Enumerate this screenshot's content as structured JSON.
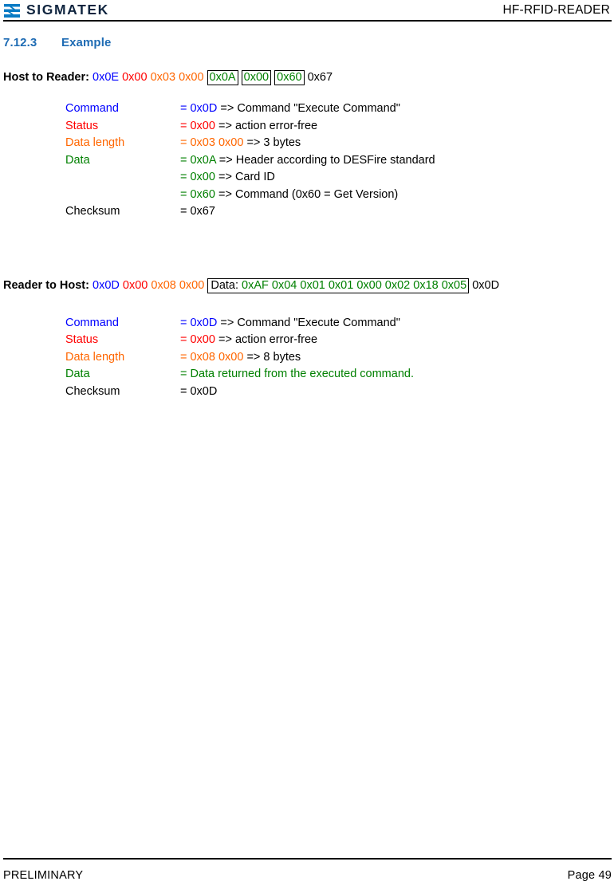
{
  "header": {
    "brand_name": "SIGMATEK",
    "logo_icon": "sigmatek-logo-icon",
    "document_title": "HF-RFID-READER"
  },
  "section": {
    "number": "7.12.3",
    "title": "Example"
  },
  "host_to_reader": {
    "lead": "Host to Reader:",
    "bytes": [
      {
        "text": "0x0E",
        "color": "#0000ff",
        "boxed": false
      },
      {
        "text": "0x00",
        "color": "#ff0000",
        "boxed": false
      },
      {
        "text": "0x03",
        "color": "#ff6600",
        "boxed": false
      },
      {
        "text": "0x00",
        "color": "#ff6600",
        "boxed": false
      },
      {
        "text": "0x0A",
        "color": "#008000",
        "boxed": true
      },
      {
        "text": "0x00",
        "color": "#008000",
        "boxed": true
      },
      {
        "text": "0x60",
        "color": "#008000",
        "boxed": true
      },
      {
        "text": "0x67",
        "color": "#000000",
        "boxed": false
      }
    ],
    "rows": [
      {
        "label": "Command",
        "label_color": "#0000ff",
        "value_prefix": "= 0x0D",
        "value_color": "#0000ff",
        "rest": " => Command \"Execute Command\""
      },
      {
        "label": "Status",
        "label_color": "#ff0000",
        "value_prefix": "= 0x00",
        "value_color": "#ff0000",
        "rest": " => action error-free"
      },
      {
        "label": "Data length",
        "label_color": "#ff6600",
        "value_prefix": "= 0x03 0x00",
        "value_color": "#ff6600",
        "rest": " => 3 bytes"
      },
      {
        "label": "Data",
        "label_color": "#008000",
        "value_prefix": "= 0x0A",
        "value_color": "#008000",
        "rest": " => Header according to DESFire standard"
      },
      {
        "label": "",
        "label_color": "#000000",
        "value_prefix": "= 0x00",
        "value_color": "#008000",
        "rest": " => Card ID"
      },
      {
        "label": "",
        "label_color": "#000000",
        "value_prefix": "= 0x60",
        "value_color": "#008000",
        "rest": " => Command (0x60 = Get Version)"
      },
      {
        "label": "Checksum",
        "label_color": "#000000",
        "value_prefix": "= 0x67",
        "value_color": "#000000",
        "rest": ""
      }
    ]
  },
  "reader_to_host": {
    "lead": "Reader to Host:",
    "bytes": [
      {
        "text": "0x0D",
        "color": "#0000ff"
      },
      {
        "text": "0x00",
        "color": "#ff0000"
      },
      {
        "text": "0x08",
        "color": "#ff6600"
      },
      {
        "text": "0x00",
        "color": "#ff6600"
      }
    ],
    "data_box_label": "Data:",
    "data_box_bytes": "0xAF 0x04 0x01 0x01 0x00 0x02 0x18 0x05",
    "trailing_byte": "0x0D",
    "rows": [
      {
        "label": "Command",
        "label_color": "#0000ff",
        "value_prefix": "= 0x0D",
        "value_color": "#0000ff",
        "rest": " => Command \"Execute Command\""
      },
      {
        "label": "Status",
        "label_color": "#ff0000",
        "value_prefix": "= 0x00",
        "value_color": "#ff0000",
        "rest": " => action error-free"
      },
      {
        "label": "Data length",
        "label_color": "#ff6600",
        "value_prefix": "=  0x08 0x00",
        "value_color": "#ff6600",
        "rest": " => 8 bytes"
      },
      {
        "label": "Data",
        "label_color": "#008000",
        "value_prefix": "= Data returned from the executed command.",
        "value_color": "#008000",
        "rest": ""
      },
      {
        "label": "Checksum",
        "label_color": "#000000",
        "value_prefix": "= 0x0D",
        "value_color": "#000000",
        "rest": ""
      }
    ]
  },
  "footer": {
    "status": "PRELIMINARY",
    "page": "Page 49"
  }
}
